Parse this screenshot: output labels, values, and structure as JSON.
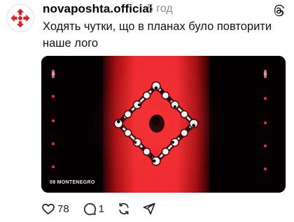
{
  "post": {
    "username": "novaposhta.official",
    "time": "5 год",
    "caption": "Ходять чутки, що в планах було повторити наше лого",
    "media": {
      "watermark": "08 MONTENEGRO",
      "type": "video"
    },
    "actions": {
      "likes": "78",
      "replies": "1"
    }
  },
  "icons": {
    "avatar": "nova-poshta-logo",
    "app": "threads-icon",
    "like": "heart-icon",
    "reply": "comment-icon",
    "repost": "repost-icon",
    "share": "share-icon"
  },
  "colors": {
    "brand_red": "#da2128",
    "secondary_text": "#8a8a8a"
  }
}
